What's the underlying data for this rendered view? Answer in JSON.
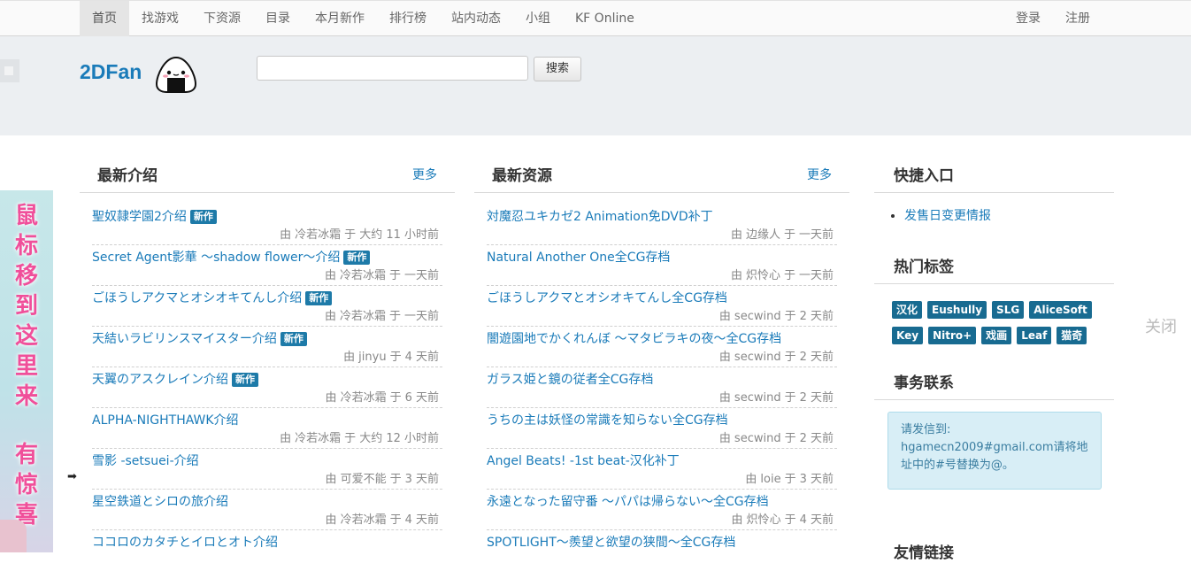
{
  "nav": {
    "items": [
      "首页",
      "找游戏",
      "下资源",
      "目录",
      "本月新作",
      "排行榜",
      "站内动态",
      "小组",
      "KF Online"
    ],
    "active": "首页",
    "login": "登录",
    "register": "注册"
  },
  "header": {
    "logo_text": "2DFan",
    "search_placeholder": "",
    "search_button": "搜索"
  },
  "intro": {
    "title": "最新介绍",
    "more": "更多",
    "entries": [
      {
        "title": "聖奴隷学園2介绍",
        "new": "新作",
        "by": "由",
        "user": "冷若冰霜",
        "at": "于",
        "time": "大约 11 小时前"
      },
      {
        "title": "Secret Agent影華 ～shadow flower～介绍",
        "new": "新作",
        "by": "由",
        "user": "冷若冰霜",
        "at": "于",
        "time": "一天前"
      },
      {
        "title": "ごほうしアクマとオシオキてんし介绍",
        "new": "新作",
        "by": "由",
        "user": "冷若冰霜",
        "at": "于",
        "time": "一天前"
      },
      {
        "title": "天結いラビリンスマイスター介绍",
        "new": "新作",
        "by": "由",
        "user": "jinyu",
        "at": "于",
        "time": "4 天前"
      },
      {
        "title": "天翼のアスクレイン介绍",
        "new": "新作",
        "by": "由",
        "user": "冷若冰霜",
        "at": "于",
        "time": "6 天前"
      },
      {
        "title": "ALPHA-NIGHTHAWK介绍",
        "new": "",
        "by": "由",
        "user": "冷若冰霜",
        "at": "于",
        "time": "大约 12 小时前"
      },
      {
        "title": "雪影 -setsuei-介绍",
        "new": "",
        "by": "由",
        "user": "可爱不能",
        "at": "于",
        "time": "3 天前"
      },
      {
        "title": "星空鉄道とシロの旅介绍",
        "new": "",
        "by": "由",
        "user": "冷若冰霜",
        "at": "于",
        "time": "4 天前"
      },
      {
        "title": "ココロのカタチとイロとオト介绍",
        "new": "",
        "by": "",
        "user": "",
        "at": "",
        "time": ""
      }
    ]
  },
  "resources": {
    "title": "最新资源",
    "more": "更多",
    "entries": [
      {
        "title": "対魔忍ユキカゼ2 Animation免DVD补丁",
        "by": "由",
        "user": "边缘人",
        "at": "于",
        "time": "一天前"
      },
      {
        "title": "Natural Another One全CG存档",
        "by": "由",
        "user": "炽怜心",
        "at": "于",
        "time": "一天前"
      },
      {
        "title": "ごほうしアクマとオシオキてんし全CG存档",
        "by": "由",
        "user": "secwind",
        "at": "于",
        "time": "2 天前"
      },
      {
        "title": "闇遊園地でかくれんぼ ～マタビラキの夜～全CG存档",
        "by": "由",
        "user": "secwind",
        "at": "于",
        "time": "2 天前"
      },
      {
        "title": "ガラス姫と鏡の従者全CG存档",
        "by": "由",
        "user": "secwind",
        "at": "于",
        "time": "2 天前"
      },
      {
        "title": "うちの主は妖怪の常識を知らない全CG存档",
        "by": "由",
        "user": "secwind",
        "at": "于",
        "time": "2 天前"
      },
      {
        "title": "Angel Beats! -1st beat-汉化补丁",
        "by": "由",
        "user": "loie",
        "at": "于",
        "time": "3 天前"
      },
      {
        "title": "永遠となった留守番 ～パパは帰らない～全CG存档",
        "by": "由",
        "user": "炽怜心",
        "at": "于",
        "time": "4 天前"
      },
      {
        "title": "SPOTLIGHT～羨望と欲望の狭間～全CG存档",
        "by": "",
        "user": "",
        "at": "",
        "time": ""
      }
    ]
  },
  "sidebar": {
    "quick_title": "快捷入口",
    "quick_links": [
      "发售日变更情报"
    ],
    "tags_title": "热门标签",
    "tags": [
      "汉化",
      "Eushully",
      "SLG",
      "AliceSoft",
      "Key",
      "Nitro+",
      "戏画",
      "Leaf",
      "猫奇"
    ],
    "contact_title": "事务联系",
    "contact_text": "请发信到: hgamecn2009#gmail.com请将地址中的#号替换为@。",
    "links_title": "友情链接"
  },
  "float_ad": {
    "text_top": "鼠标移到这里来",
    "text_bottom": "有惊喜"
  },
  "close_label": "关闭"
}
